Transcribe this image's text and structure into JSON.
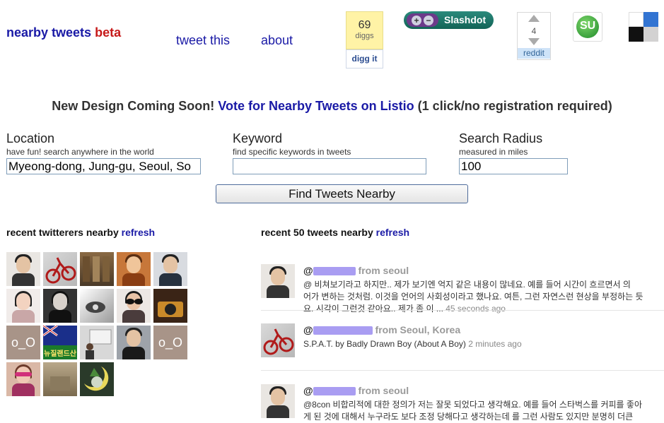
{
  "header": {
    "logo_main": "nearby tweets",
    "logo_beta": "beta",
    "nav": [
      "tweet this",
      "about"
    ],
    "digg": {
      "count": "69",
      "unit": "diggs",
      "button": "digg it"
    },
    "slashdot": {
      "label": "Slashdot",
      "plus": "+",
      "minus": "−"
    },
    "reddit": {
      "count": "4",
      "label": "reddit"
    },
    "stumbleupon": {
      "glyph": "SU"
    }
  },
  "announcement": {
    "lead": "New Design Coming Soon!",
    "link": "Vote for Nearby Tweets on Listio",
    "tail": "(1 click/no registration required)"
  },
  "form": {
    "location": {
      "title": "Location",
      "hint": "have fun! search anywhere in the world",
      "value": "Myeong-dong, Jung-gu, Seoul, So"
    },
    "keyword": {
      "title": "Keyword",
      "hint": "find specific keywords in tweets",
      "value": ""
    },
    "radius": {
      "title": "Search Radius",
      "hint": "measured in miles",
      "value": "100"
    },
    "submit": "Find Tweets Nearby"
  },
  "recent_twitterers": {
    "heading": "recent twitterers nearby",
    "refresh": "refresh",
    "avatar_labels": [
      "o_O",
      "뉴질랜드산",
      "o_O"
    ]
  },
  "recent_tweets": {
    "heading": "recent 50 tweets nearby",
    "refresh": "refresh",
    "items": [
      {
        "user_prefix": "@",
        "from": "from seoul",
        "text_lines": [
          "@     비쳐보기라고 하지만.. 제가 보기엔 억지 같은 내용이 많네요. 예를 들어 시간이 흐르면서 의",
          "어가 변하는 것처럼. 이것을 언어의 사회성이라고 했나요. 여튼, 그런 자연스런 현상을 부정하는 듯",
          "요. 시각이 그런것 같아요.. 제가 좀 이 ..."
        ],
        "time": "45 seconds ago"
      },
      {
        "user_prefix": "@",
        "from": "from Seoul, Korea",
        "text_lines": [
          "S.P.A.T. by Badly Drawn Boy (About A Boy)"
        ],
        "time": "2 minutes ago"
      },
      {
        "user_prefix": "@",
        "from": "from seoul",
        "text_lines": [
          "@8con 비합리적에 대한 정의가 저는 잘못 되었다고 생각해요. 예를 들어 스타벅스를 커피를 좋아",
          "게 된 것에 대해서 누구라도 보다 조정 당해다고 생각하는데 를 그런 사람도 있지만 분명히 더큰"
        ],
        "time": ""
      }
    ]
  },
  "colors": {
    "link": "#1a1aa6",
    "beta": "#c61a1a",
    "digg_bg": "#fff3a6",
    "reddit_bg": "#cee3f8"
  }
}
